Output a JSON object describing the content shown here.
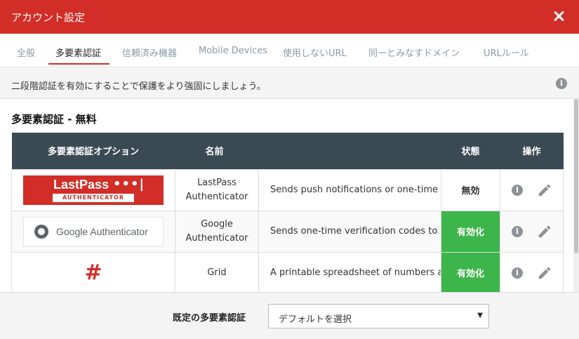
{
  "window": {
    "title": "アカウント設定",
    "close_icon": "close-icon"
  },
  "tabs": [
    {
      "label": "全般",
      "active": false
    },
    {
      "label": "多要素認証",
      "active": true
    },
    {
      "label": "信頼済み機器",
      "active": false
    },
    {
      "label": "Mobile Devices",
      "active": false
    },
    {
      "label": "使用しないURL",
      "active": false
    },
    {
      "label": "同一とみなすドメイン",
      "active": false
    },
    {
      "label": "URLルール",
      "active": false
    }
  ],
  "info_bar": {
    "text": "二段階認証を有効にすることで保護をより強固にしましょう。",
    "icon": "info-icon"
  },
  "section": {
    "title": "多要素認証 - 無料"
  },
  "table": {
    "headers": {
      "option": "多要素認証オプション",
      "name": "名前",
      "status": "状態",
      "actions": "操作"
    },
    "rows": [
      {
        "logo": "lastpass-authenticator-logo",
        "logo_text": "LastPass",
        "logo_dots": "•••|",
        "logo_sub": "AUTHENTICATOR",
        "name": "LastPass Authenticator",
        "description": "Sends push notifications or one-time",
        "status": "無効",
        "enabled": false
      },
      {
        "logo": "google-authenticator-logo",
        "logo_text": "Google Authenticator",
        "name": "Google Authenticator",
        "description": "Sends one-time verification codes to",
        "status": "有効化",
        "enabled": true
      },
      {
        "logo": "grid-logo",
        "logo_text": "#",
        "name": "Grid",
        "description": "A printable spreadsheet of numbers a",
        "status": "有効化",
        "enabled": true
      }
    ]
  },
  "footer": {
    "label": "既定の多要素認証",
    "select_value": "デフォルトを選択"
  },
  "colors": {
    "brand": "#d32d27",
    "header_bg": "#3a4a53",
    "enabled": "#3cb54a"
  }
}
